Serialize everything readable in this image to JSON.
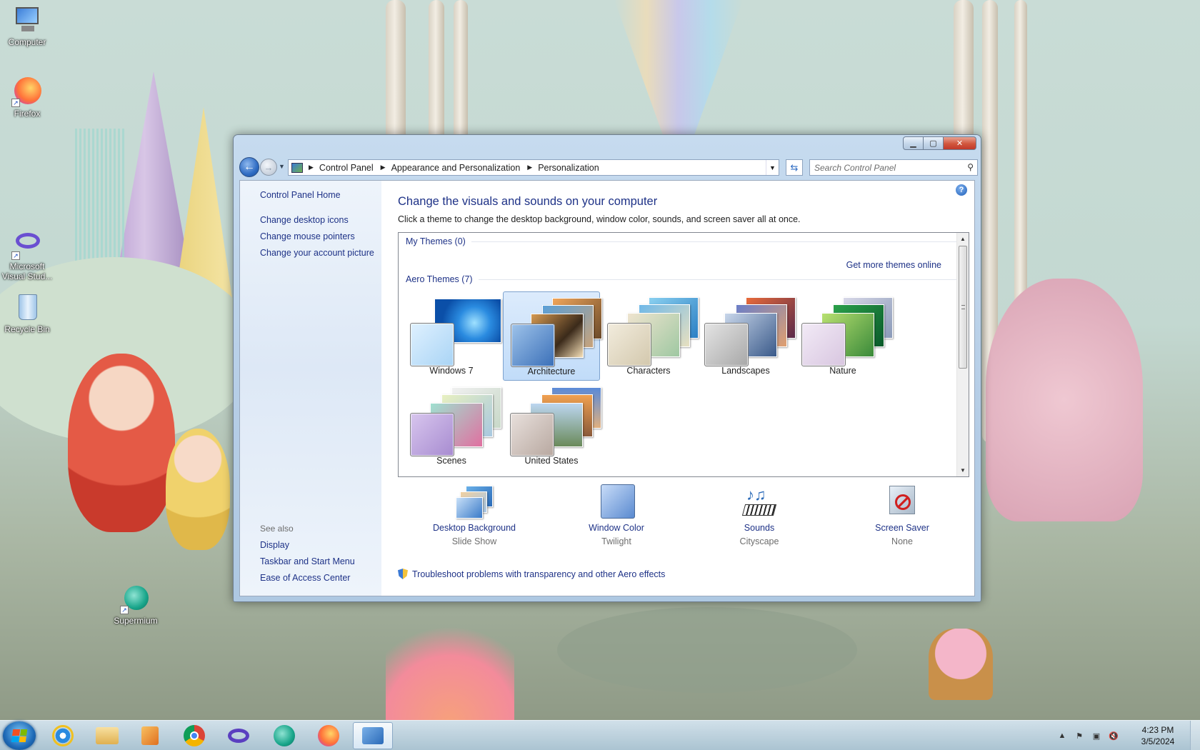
{
  "desktop": {
    "icons": [
      {
        "label": "Computer",
        "icon": "computer-icon"
      },
      {
        "label": "Firefox",
        "icon": "firefox-icon"
      },
      {
        "label": "Microsoft Visual Stud...",
        "icon": "visual-studio-icon"
      },
      {
        "label": "Recycle Bin",
        "icon": "recycle-bin-icon"
      },
      {
        "label": "Supermium",
        "icon": "supermium-icon"
      }
    ]
  },
  "window": {
    "breadcrumb": [
      "Control Panel",
      "Appearance and Personalization",
      "Personalization"
    ],
    "search_placeholder": "Search Control Panel",
    "help_glyph": "?"
  },
  "left_pane": {
    "home": "Control Panel Home",
    "links": [
      "Change desktop icons",
      "Change mouse pointers",
      "Change your account picture"
    ],
    "see_also_label": "See also",
    "see_also_links": [
      "Display",
      "Taskbar and Start Menu",
      "Ease of Access Center"
    ]
  },
  "main": {
    "title": "Change the visuals and sounds on your computer",
    "subtitle": "Click a theme to change the desktop background, window color, sounds, and screen saver all at once.",
    "my_themes_header": "My Themes (0)",
    "get_more_link": "Get more themes online",
    "aero_themes_header": "Aero Themes (7)",
    "themes": [
      {
        "name": "Windows 7",
        "selected": false
      },
      {
        "name": "Architecture",
        "selected": true
      },
      {
        "name": "Characters",
        "selected": false
      },
      {
        "name": "Landscapes",
        "selected": false
      },
      {
        "name": "Nature",
        "selected": false
      },
      {
        "name": "Scenes",
        "selected": false
      },
      {
        "name": "United States",
        "selected": false
      }
    ],
    "bottom_items": [
      {
        "label": "Desktop Background",
        "value": "Slide Show"
      },
      {
        "label": "Window Color",
        "value": "Twilight"
      },
      {
        "label": "Sounds",
        "value": "Cityscape"
      },
      {
        "label": "Screen Saver",
        "value": "None"
      }
    ],
    "troubleshoot_link": "Troubleshoot problems with transparency and other Aero effects"
  },
  "taskbar": {
    "pinned": [
      "internet-explorer-icon",
      "file-explorer-icon",
      "media-player-icon",
      "chrome-icon",
      "visual-studio-icon",
      "supermium-icon",
      "firefox-icon",
      "control-panel-icon"
    ],
    "clock_time": "4:23 PM",
    "clock_date": "3/5/2024"
  },
  "colors": {
    "link": "#1e3287",
    "selected_theme_bg": "#c1dcf9",
    "close_button": "#c0392b"
  }
}
